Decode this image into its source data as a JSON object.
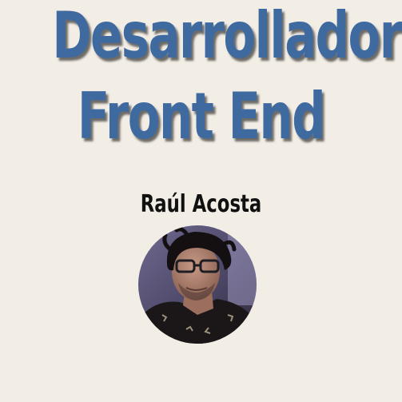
{
  "hero": {
    "title_line_1": "Desarrollador",
    "title_line_2": "Front End"
  },
  "profile": {
    "name": "Raúl Acosta",
    "avatar": "profile-photo"
  },
  "colors": {
    "background": "#f2ede5",
    "title": "#3f6aa0",
    "name": "#111111"
  }
}
